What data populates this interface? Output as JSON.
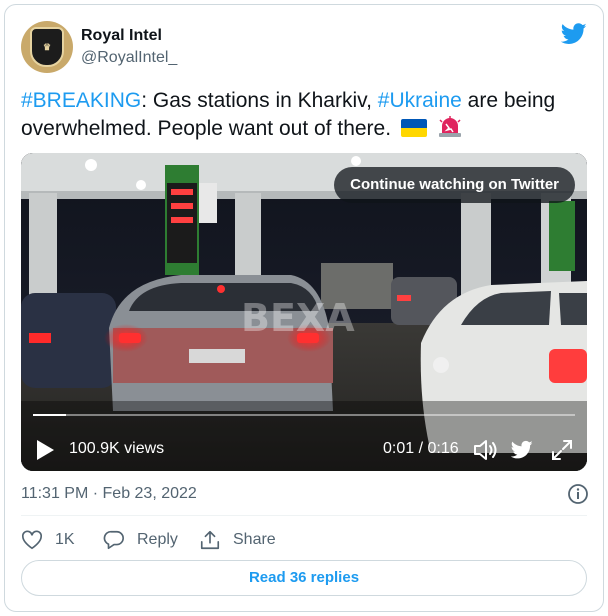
{
  "author": {
    "name": "Royal Intel",
    "handle": "@RoyalIntel_",
    "avatar_letters": "ROYAL INTEL"
  },
  "tweet": {
    "hashtag1": "#BREAKING",
    "text1": ": Gas stations in Kharkiv, ",
    "hashtag2": "#Ukraine",
    "text2": " are being overwhelmed. People want out of there.",
    "emojis": [
      "ukraine-flag",
      "rotating-light"
    ]
  },
  "video": {
    "continue_label": "Continue watching on Twitter",
    "views": "100.9K views",
    "time": "0:01 / 0:16",
    "progress": 0.06,
    "watermark": "BEXA"
  },
  "meta": {
    "timestamp": "11:31 PM · Feb 23, 2022"
  },
  "actions": {
    "likes": "1K",
    "reply_label": "Reply",
    "share_label": "Share"
  },
  "footer": {
    "read_replies": "Read 36 replies"
  },
  "colors": {
    "accent": "#1d9bf0",
    "text": "#0f1419",
    "muted": "#536471",
    "border": "#cfd9de"
  }
}
